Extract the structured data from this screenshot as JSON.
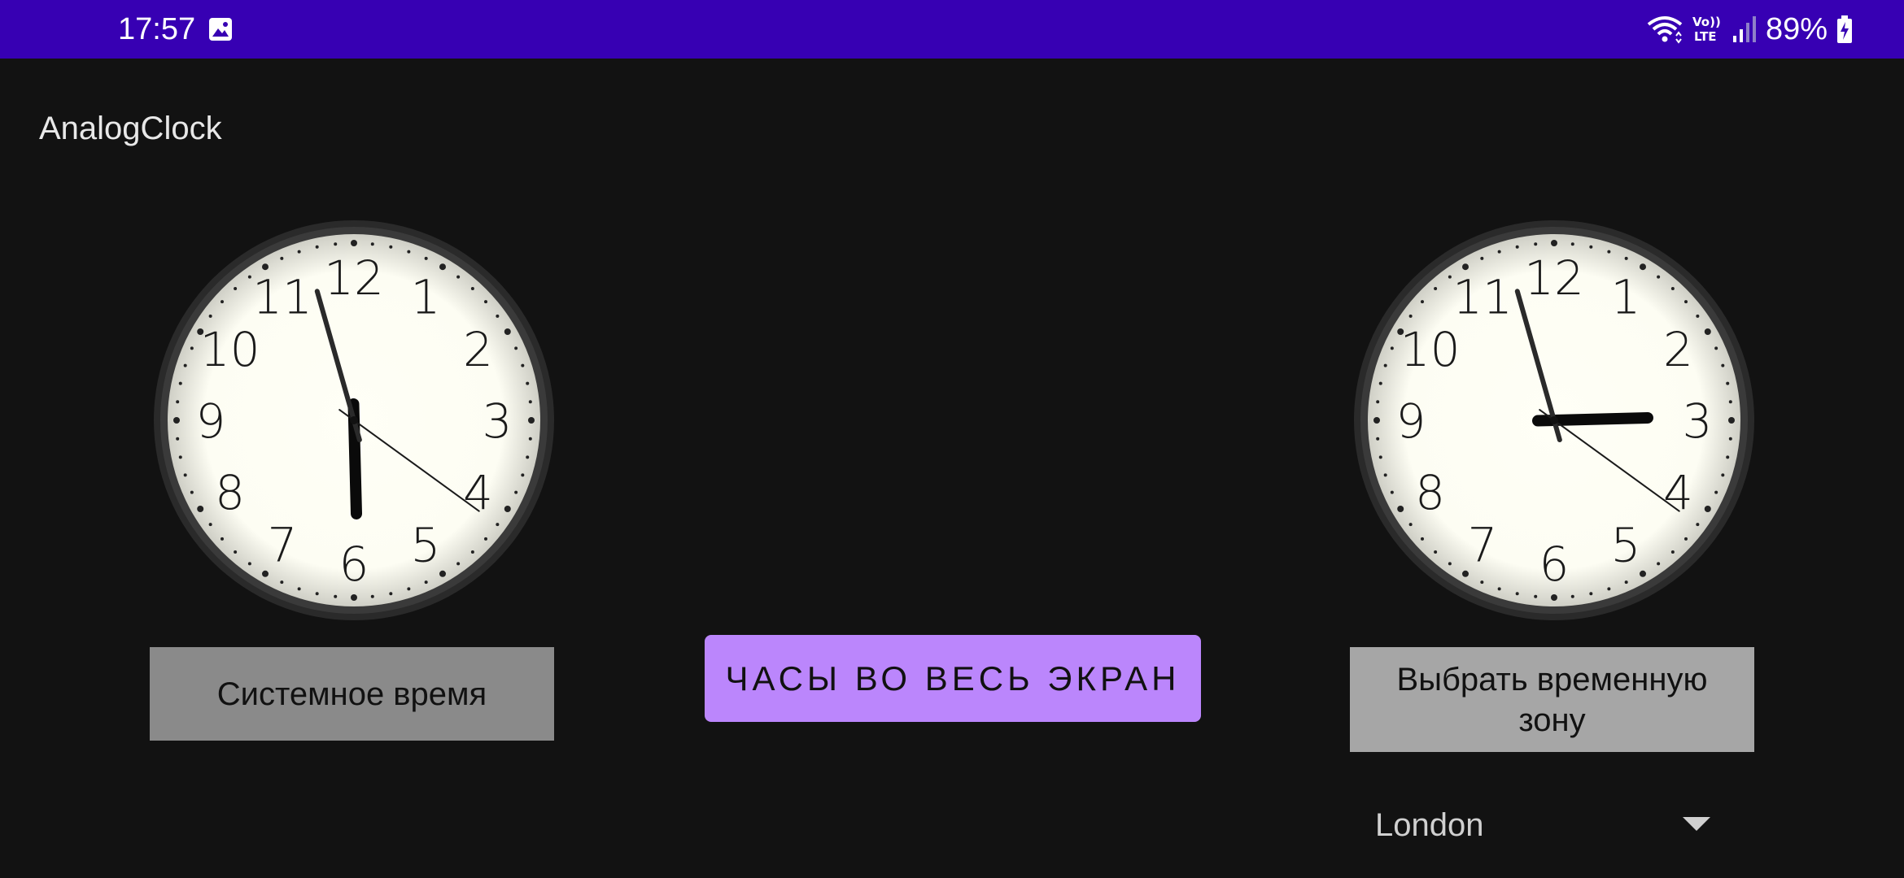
{
  "status_bar": {
    "time": "17:57",
    "battery": "89%",
    "volte_top": "Vo))",
    "volte_bottom": "LTE",
    "icons": [
      "gallery-icon",
      "wifi-icon",
      "volte-icon",
      "signal-icon",
      "battery-charging-icon"
    ],
    "color": "#3700b3"
  },
  "app": {
    "title": "AnalogClock"
  },
  "clocks": {
    "numerals": [
      "12",
      "1",
      "2",
      "3",
      "4",
      "5",
      "6",
      "7",
      "8",
      "9",
      "10",
      "11"
    ],
    "system": {
      "time": "17:57:21"
    },
    "zone": {
      "time": "14:57:21"
    }
  },
  "buttons": {
    "system_time": "Системное время",
    "fullscreen": "ЧАСЫ ВО ВЕСЬ ЭКРАН",
    "choose_timezone": "Выбрать временную зону"
  },
  "timezone_spinner": {
    "selected": "London"
  },
  "colors": {
    "background": "#121212",
    "accent": "#bb86fc",
    "button_gray": "#8a8a8a",
    "button_light_gray": "#a6a6a6",
    "clock_face": "#fdfdf3",
    "clock_rim": "#3a3a3a"
  }
}
